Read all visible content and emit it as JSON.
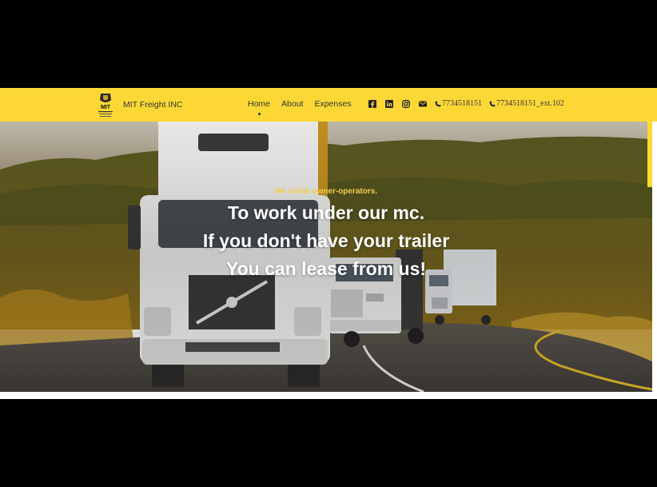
{
  "brand": {
    "name": "MIT Freight INC",
    "logo_text": "MIT"
  },
  "nav": {
    "items": [
      {
        "label": "Home",
        "active": true
      },
      {
        "label": "About",
        "active": false
      },
      {
        "label": "Expenses",
        "active": false
      }
    ]
  },
  "social": [
    "facebook-icon",
    "linkedin-icon",
    "instagram-icon",
    "envelope-icon"
  ],
  "phones": [
    {
      "label": "7734518151"
    },
    {
      "label": "7734518151_ext.102"
    }
  ],
  "hero": {
    "tagline": "We invite owner-operators.",
    "line1": "To work under our mc.",
    "line2": "If you don't have your trailer",
    "line3": "You can lease from us!"
  },
  "colors": {
    "accent": "#fdd835",
    "tagline": "#f2c94c",
    "background": "#000000"
  }
}
